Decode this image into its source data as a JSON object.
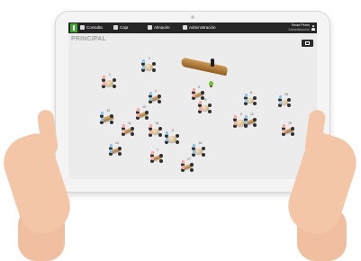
{
  "nav": {
    "items": [
      {
        "label": "Consulta",
        "icon": "search-icon"
      },
      {
        "label": "Caja",
        "icon": "cash-register-icon"
      },
      {
        "label": "Almacén",
        "icon": "warehouse-icon"
      },
      {
        "label": "Administración",
        "icon": "gear-icon"
      }
    ]
  },
  "user": {
    "name": "Smart Pedro",
    "role": "Administración"
  },
  "floor": {
    "title": "PRINCIPAL"
  },
  "tables": [
    {
      "number": "1",
      "type": "round",
      "color": "#f5a7a1"
    },
    {
      "number": "2",
      "type": "round",
      "color": "#8ec5e6"
    },
    {
      "number": "3",
      "type": "rect",
      "color": "#f5a7a1"
    },
    {
      "number": "4",
      "type": "rect",
      "color": "#8ec5e6"
    },
    {
      "number": "5",
      "type": "round",
      "color": "#f5a7a1"
    },
    {
      "number": "6",
      "type": "round",
      "color": "#8ec5e6"
    },
    {
      "number": "7",
      "type": "rect",
      "color": "#f5a7a1"
    },
    {
      "number": "8",
      "type": "round",
      "color": "#8ec5e6"
    },
    {
      "number": "9",
      "type": "round",
      "color": "#f5a7a1"
    },
    {
      "number": "10",
      "type": "rect",
      "color": "#8ec5e6"
    },
    {
      "number": "11",
      "type": "rect",
      "color": "#f5a7a1"
    },
    {
      "number": "12",
      "type": "rect",
      "color": "#8ec5e6"
    },
    {
      "number": "13",
      "type": "rect",
      "color": "#f5a7a1"
    },
    {
      "number": "14",
      "type": "rect",
      "color": "#8ec5e6"
    },
    {
      "number": "15",
      "type": "round",
      "color": "#f5a7a1"
    },
    {
      "number": "16",
      "type": "round",
      "color": "#8ec5e6"
    },
    {
      "number": "17",
      "type": "rect",
      "color": "#f5a7a1"
    },
    {
      "number": "18",
      "type": "round",
      "color": "#8ec5e6"
    },
    {
      "number": "19",
      "type": "rect",
      "color": "#f5a7a1"
    }
  ],
  "colors": {
    "topbar": "#262626",
    "logo": "#3ea62f",
    "floor": "#ececec"
  }
}
